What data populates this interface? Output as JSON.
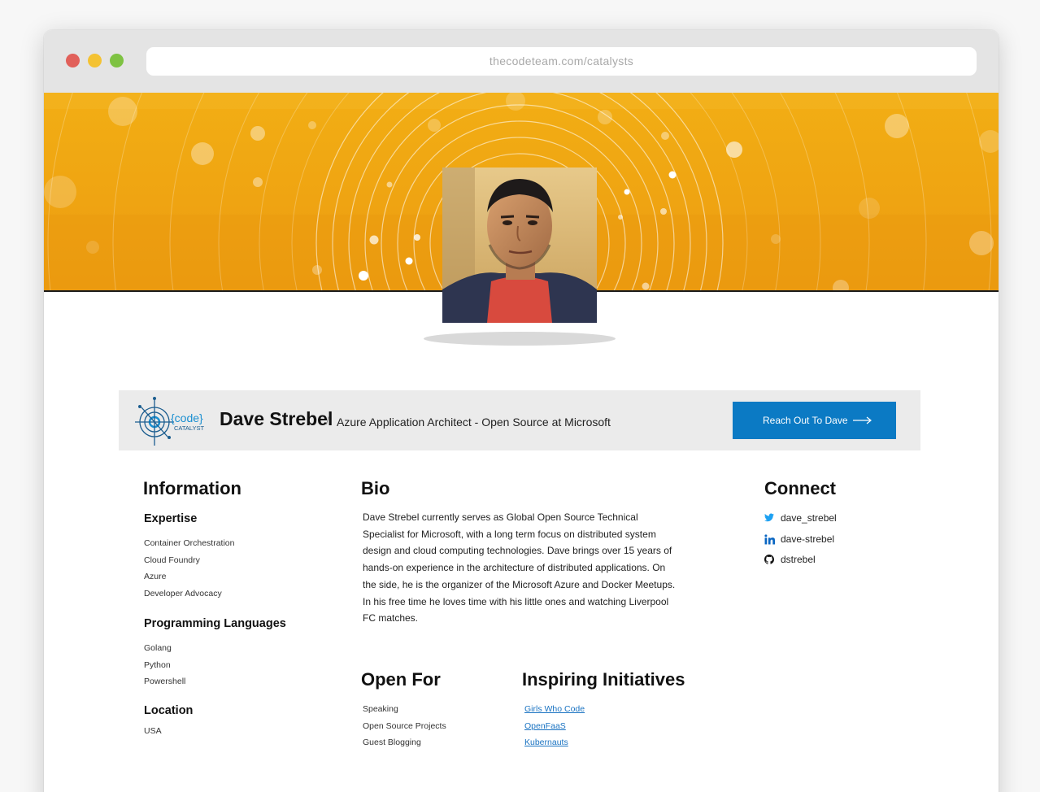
{
  "browser": {
    "url": "thecodeteam.com/catalysts"
  },
  "profile": {
    "name": "Dave Strebel",
    "separator": "/",
    "title": "Azure Application Architect - Open Source at Microsoft",
    "cta_label": "Reach Out To Dave",
    "logo_text": {
      "top": "{code}",
      "bottom": "CATALYST"
    }
  },
  "information": {
    "heading": "Information",
    "expertise": {
      "heading": "Expertise",
      "items": [
        "Container Orchestration",
        "Cloud Foundry",
        "Azure",
        "Developer Advocacy"
      ]
    },
    "languages": {
      "heading": "Programming Languages",
      "items": [
        "Golang",
        "Python",
        "Powershell"
      ]
    },
    "location": {
      "heading": "Location",
      "value": "USA"
    }
  },
  "bio": {
    "heading": "Bio",
    "text": "Dave Strebel currently serves as Global Open Source Technical Specialist for Microsoft, with a long term focus on distributed system design and cloud computing technologies. Dave brings over 15 years of hands-on experience in the architecture of distributed applications. On the side, he is the organizer of the Microsoft Azure and Docker Meetups. In his free time he loves time with his little ones and watching Liverpool FC matches."
  },
  "open_for": {
    "heading": "Open For",
    "items": [
      "Speaking",
      "Open Source Projects",
      "Guest Blogging"
    ]
  },
  "initiatives": {
    "heading": "Inspiring Initiatives",
    "items": [
      "Girls Who Code",
      "OpenFaaS",
      "Kubernauts"
    ]
  },
  "connect": {
    "heading": "Connect",
    "items": [
      {
        "icon": "twitter-icon",
        "label": "dave_strebel"
      },
      {
        "icon": "linkedin-icon",
        "label": "dave-strebel"
      },
      {
        "icon": "github-icon",
        "label": "dstrebel"
      }
    ]
  },
  "colors": {
    "hero": "#efa412",
    "cta": "#0b7ac4",
    "link": "#1a73c2",
    "twitter": "#1da1f2",
    "linkedin": "#0a66c2"
  }
}
